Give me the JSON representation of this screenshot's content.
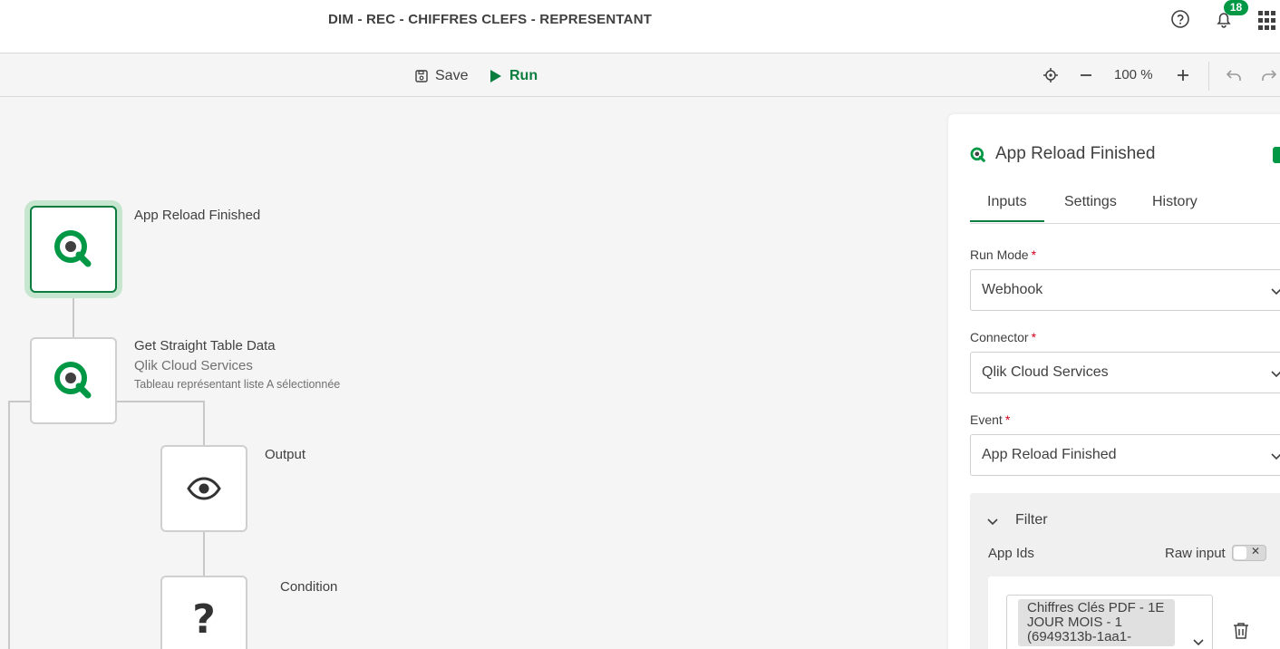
{
  "header": {
    "title": "DIM - REC - CHIFFRES CLEFS - REPRESENTANT",
    "notification_count": "18",
    "help_icon": "help-circle-icon",
    "bell_icon": "bell-icon",
    "apps_icon": "app-grid-icon"
  },
  "toolbar": {
    "save_label": "Save",
    "run_label": "Run",
    "zoom_level": "100 %"
  },
  "canvas": {
    "nodes": [
      {
        "label": "App Reload Finished",
        "icon": "qlik-icon"
      },
      {
        "label": "Get Straight Table Data",
        "sublabel": "Qlik Cloud Services",
        "description": "Tableau représentant liste A sélectionnée",
        "icon": "qlik-icon"
      },
      {
        "label": "Output",
        "icon": "eye-icon"
      },
      {
        "label": "Condition",
        "icon": "question-icon",
        "glyph": "?"
      }
    ]
  },
  "panel": {
    "title": "App Reload Finished",
    "tabs": [
      "Inputs",
      "Settings",
      "History"
    ],
    "fields": {
      "run_mode": {
        "label": "Run Mode",
        "required": "*",
        "value": "Webhook"
      },
      "connector": {
        "label": "Connector",
        "required": "*",
        "value": "Qlik Cloud Services"
      },
      "event": {
        "label": "Event",
        "required": "*",
        "value": "App Reload Finished"
      }
    },
    "filter": {
      "title": "Filter",
      "app_ids_label": "App Ids",
      "raw_input_label": "Raw input",
      "toggle_x": "✕",
      "selected_app": "Chiffres Clés PDF - 1E JOUR MOIS - 1 (6949313b-1aa1-"
    }
  },
  "colors": {
    "accent": "#009845",
    "accent_dark": "#0b7d3e",
    "selection_glow": "#c7e6cf"
  }
}
